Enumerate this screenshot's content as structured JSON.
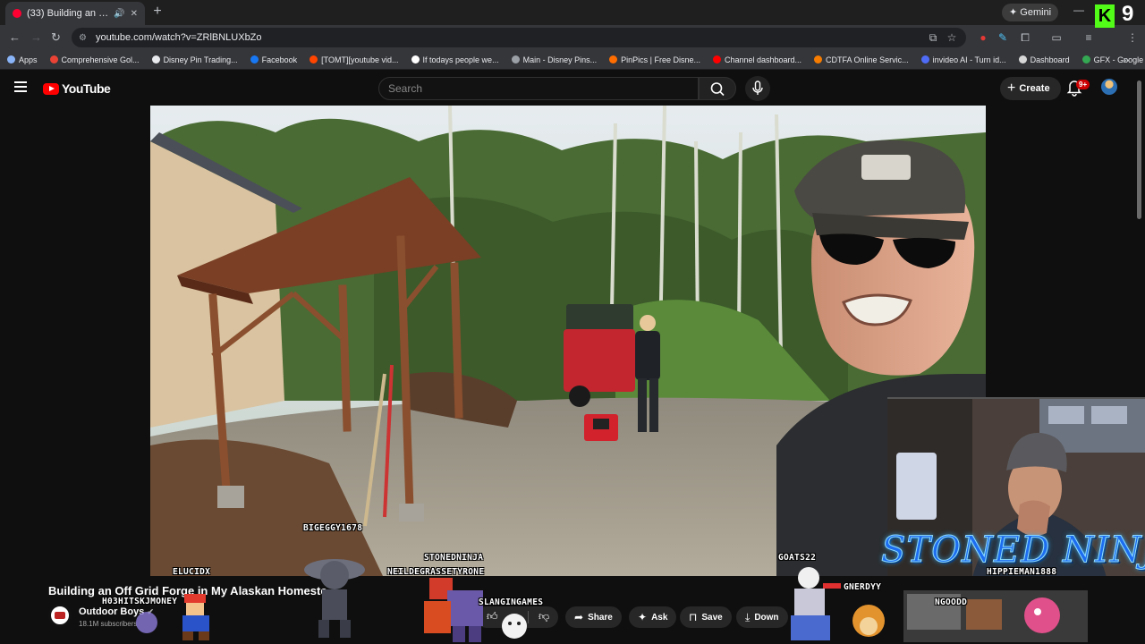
{
  "browser": {
    "tab_title": "(33) Building an Off Grid Fo",
    "new_tab": "+",
    "gemini_label": "Gemini",
    "url": "youtube.com/watch?v=ZRlBNLUXbZo",
    "bookmarks": [
      {
        "label": "Apps",
        "color": "#8ab4f8"
      },
      {
        "label": "Comprehensive Gol...",
        "color": "#ea4335"
      },
      {
        "label": "Disney Pin Trading...",
        "color": "#e8eaed"
      },
      {
        "label": "Facebook",
        "color": "#1877f2"
      },
      {
        "label": "[TOMT][youtube vid...",
        "color": "#ff4500"
      },
      {
        "label": "If todays people we...",
        "color": "#ffffff"
      },
      {
        "label": "Main - Disney Pins...",
        "color": "#9aa0a6"
      },
      {
        "label": "PinPics | Free Disne...",
        "color": "#ff6d00"
      },
      {
        "label": "Channel dashboard...",
        "color": "#ff0000"
      },
      {
        "label": "CDTFA Online Servic...",
        "color": "#f57c00"
      },
      {
        "label": "invideo AI - Turn id...",
        "color": "#4f6cf7"
      },
      {
        "label": "Dashboard",
        "color": "#d7d7d7"
      },
      {
        "label": "GFX - Google Drive",
        "color": "#34a853"
      }
    ],
    "overlay_k": "K",
    "overlay_number": "9"
  },
  "youtube": {
    "logo_text": "YouTube",
    "search_placeholder": "Search",
    "create_label": "Create",
    "notifications_badge": "9+"
  },
  "video": {
    "title": "Building an Off Grid Forge in My Alaskan Homeste",
    "channel": "Outdoor Boys",
    "subscribers": "18.1M subscribers",
    "share_label": "Share",
    "ask_label": "Ask",
    "save_label": "Save",
    "download_label": "Down"
  },
  "stream_overlay": {
    "logo_text": "STONED NINJA",
    "chat_names": [
      "BIGEGGY1678",
      "ELUCIDX",
      "H03HITSKJMONEY",
      "STONEDNINJA",
      "NEILDEGRASSETYRONE",
      "SLANGINGAMES",
      "GOATS22",
      "GNERDYY",
      "HIPPIEMAN1888",
      "NGOODD"
    ]
  }
}
